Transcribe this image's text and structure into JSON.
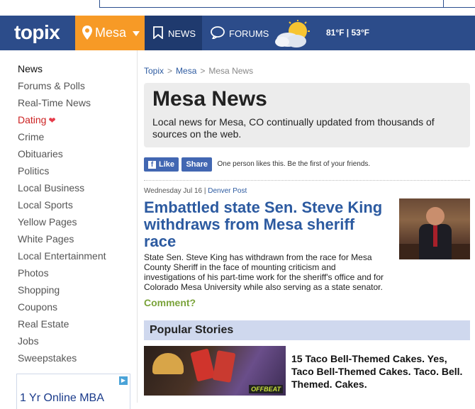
{
  "brand": {
    "logo": "topix",
    "accent": "#f79a26",
    "nav_bg": "#2c4c8a"
  },
  "location": {
    "label": "Mesa"
  },
  "nav": {
    "news": "NEWS",
    "forums": "FORUMS"
  },
  "weather": {
    "icon": "partly-cloudy-icon",
    "temp": "81°F | 53°F"
  },
  "sidebar": {
    "items": [
      {
        "label": "News"
      },
      {
        "label": "Forums & Polls"
      },
      {
        "label": "Real-Time News"
      },
      {
        "label": "Dating"
      },
      {
        "label": "Crime"
      },
      {
        "label": "Obituaries"
      },
      {
        "label": "Politics"
      },
      {
        "label": "Local Business"
      },
      {
        "label": "Local Sports"
      },
      {
        "label": "Yellow Pages"
      },
      {
        "label": "White Pages"
      },
      {
        "label": "Local Entertainment"
      },
      {
        "label": "Photos"
      },
      {
        "label": "Shopping"
      },
      {
        "label": "Coupons"
      },
      {
        "label": "Real Estate"
      },
      {
        "label": "Jobs"
      },
      {
        "label": "Sweepstakes"
      }
    ],
    "ad_text": "1 Yr Online MBA"
  },
  "breadcrumb": {
    "home": "Topix",
    "city": "Mesa",
    "current": "Mesa News"
  },
  "header": {
    "title": "Mesa News",
    "description": "Local news for Mesa, CO continually updated from thousands of sources on the web."
  },
  "social": {
    "like": "Like",
    "share": "Share",
    "note": "One person likes this. Be the first of your friends."
  },
  "article": {
    "date": "Wednesday Jul 16",
    "source": "Denver Post",
    "headline": "Embattled state Sen. Steve King withdraws from Mesa sheriff race",
    "summary": "State Sen. Steve King has withdrawn from the race for Mesa County Sheriff in the face of mounting criticism and investigations of his part-time work for the sheriff's office and for Colorado Mesa University while also serving as a state senator.",
    "comment": "Comment?"
  },
  "popular": {
    "heading": "Popular Stories",
    "stories": [
      {
        "title": "15 Taco Bell-Themed Cakes. Yes, Taco Bell-Themed Cakes. Taco. Bell. Themed. Cakes.",
        "badge": "OFFBEAT"
      }
    ]
  }
}
